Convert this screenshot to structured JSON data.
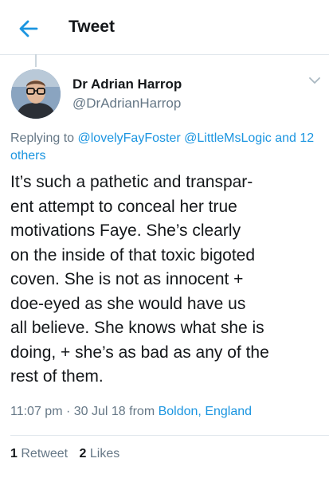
{
  "header": {
    "title": "Tweet",
    "back_icon": "arrow-left-icon"
  },
  "author": {
    "name": "Dr Adrian Harrop",
    "handle": "@DrAdrianHarrop",
    "avatar_icon": "avatar"
  },
  "reply": {
    "prefix": "Replying to",
    "mention1": "@lovelyFayFoster",
    "mention2": "@LittleMsLogic",
    "conjunction": "and",
    "others": "12 others"
  },
  "tweet": {
    "lines": [
      "It’s such a pathetic and transpar-",
      "ent attempt to conceal her true",
      "motivations Faye. She’s clearly",
      "on the inside of that toxic bigoted",
      "coven. She is not as innocent +",
      "doe-eyed as she would have us",
      "all believe. She knows what she is",
      "doing, + she’s as bad as any of the",
      "rest of them."
    ]
  },
  "meta": {
    "time": "11:07 pm",
    "separator": "·",
    "date": "30 Jul 18",
    "from_label": "from",
    "location": "Boldon, England"
  },
  "stats": {
    "retweet_count": "1",
    "retweet_label": "Retweet",
    "likes_count": "2",
    "likes_label": "Likes"
  },
  "colors": {
    "accent": "#1b95e0",
    "muted": "#657786",
    "text": "#14171a",
    "divider": "#e1e8ed"
  }
}
